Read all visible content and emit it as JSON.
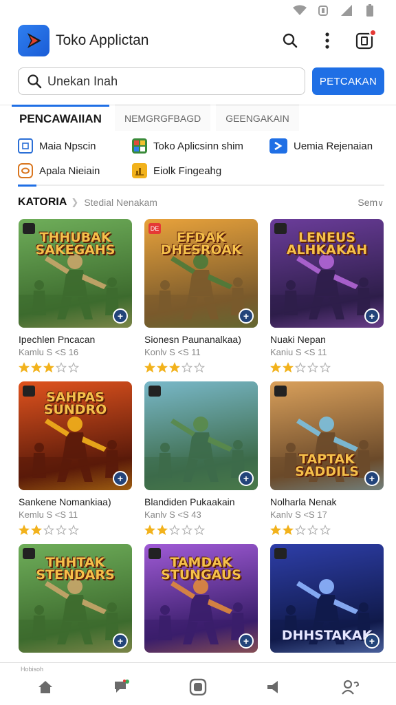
{
  "app": {
    "title": "Toko Applictan"
  },
  "search": {
    "placeholder": "Unekan Inah",
    "button_label": "PETCAKAN"
  },
  "tabs": [
    {
      "label": "PENCAWAIIAN"
    },
    {
      "label": "NEMGRGFBAGD"
    },
    {
      "label": "GEENGAKAIN"
    }
  ],
  "quick_links": [
    {
      "label": "Maia Npscin",
      "icon": "square-outline-icon",
      "color": "#2b6fd6"
    },
    {
      "label": "Toko Aplicsinn shim",
      "icon": "games-grid-icon",
      "color": "#3a8a3a"
    },
    {
      "label": "Uemia Rejenaian",
      "icon": "play-chevron-icon",
      "color": "#1f6fe5"
    },
    {
      "label": "Apala Nieiain",
      "icon": "ring-icon",
      "color": "#d9761f"
    },
    {
      "label": "Eiolk Fingeahg",
      "icon": "chart-icon",
      "color": "#f2b21c"
    }
  ],
  "section": {
    "title": "KATORIA",
    "subtitle": "Stedial Nenakam",
    "more": "Sem"
  },
  "games": [
    {
      "name": "Ipechlen Pncacan",
      "meta": "Kamlu S &lt;S 16",
      "rating": 3,
      "cover_title": "THHUBAK SAKEGAHS",
      "badge": "",
      "palette": "green"
    },
    {
      "name": "Sionesn Paunanalkaa)",
      "meta": "Konlv S &lt;S 11",
      "rating": 3,
      "cover_title": "EFDAK DHESROAK",
      "badge": "DE",
      "palette": "gold"
    },
    {
      "name": "Nuaki Nepan",
      "meta": "Kaniu S &lt;S 11",
      "rating": 2,
      "cover_title": "LENEUS ALHKAKAH",
      "badge": "",
      "palette": "purple"
    },
    {
      "name": "Sankene Nomankiaa)",
      "meta": "Kemlu S &lt;S 11",
      "rating": 2,
      "cover_title": "SAHPAS SUNDRO",
      "badge": "",
      "palette": "fire"
    },
    {
      "name": "Blandiden Pukaakain",
      "meta": "Kanlv S &lt;S 43",
      "rating": 2,
      "cover_title": "",
      "badge": "",
      "palette": "teal"
    },
    {
      "name": "Nolharla Nenak",
      "meta": "Kanlv S &lt;S 17",
      "rating": 2,
      "cover_title": "TAPTAK SADDILS",
      "badge": "",
      "palette": "warm"
    },
    {
      "name": "",
      "meta": "",
      "rating": 0,
      "cover_title": "THHTAK STENDARS",
      "badge": "",
      "palette": "green"
    },
    {
      "name": "",
      "meta": "",
      "rating": 0,
      "cover_title": "TAMDAK STUNGAUS",
      "badge": "",
      "palette": "violet"
    },
    {
      "name": "",
      "meta": "",
      "rating": 0,
      "cover_title": "DHHSTAKAK",
      "badge": "",
      "palette": "storm"
    }
  ],
  "bottom_nav": {
    "home_label": "Hobisoh"
  },
  "colors": {
    "accent": "#1f6fe5",
    "star": "#f2b21c"
  }
}
